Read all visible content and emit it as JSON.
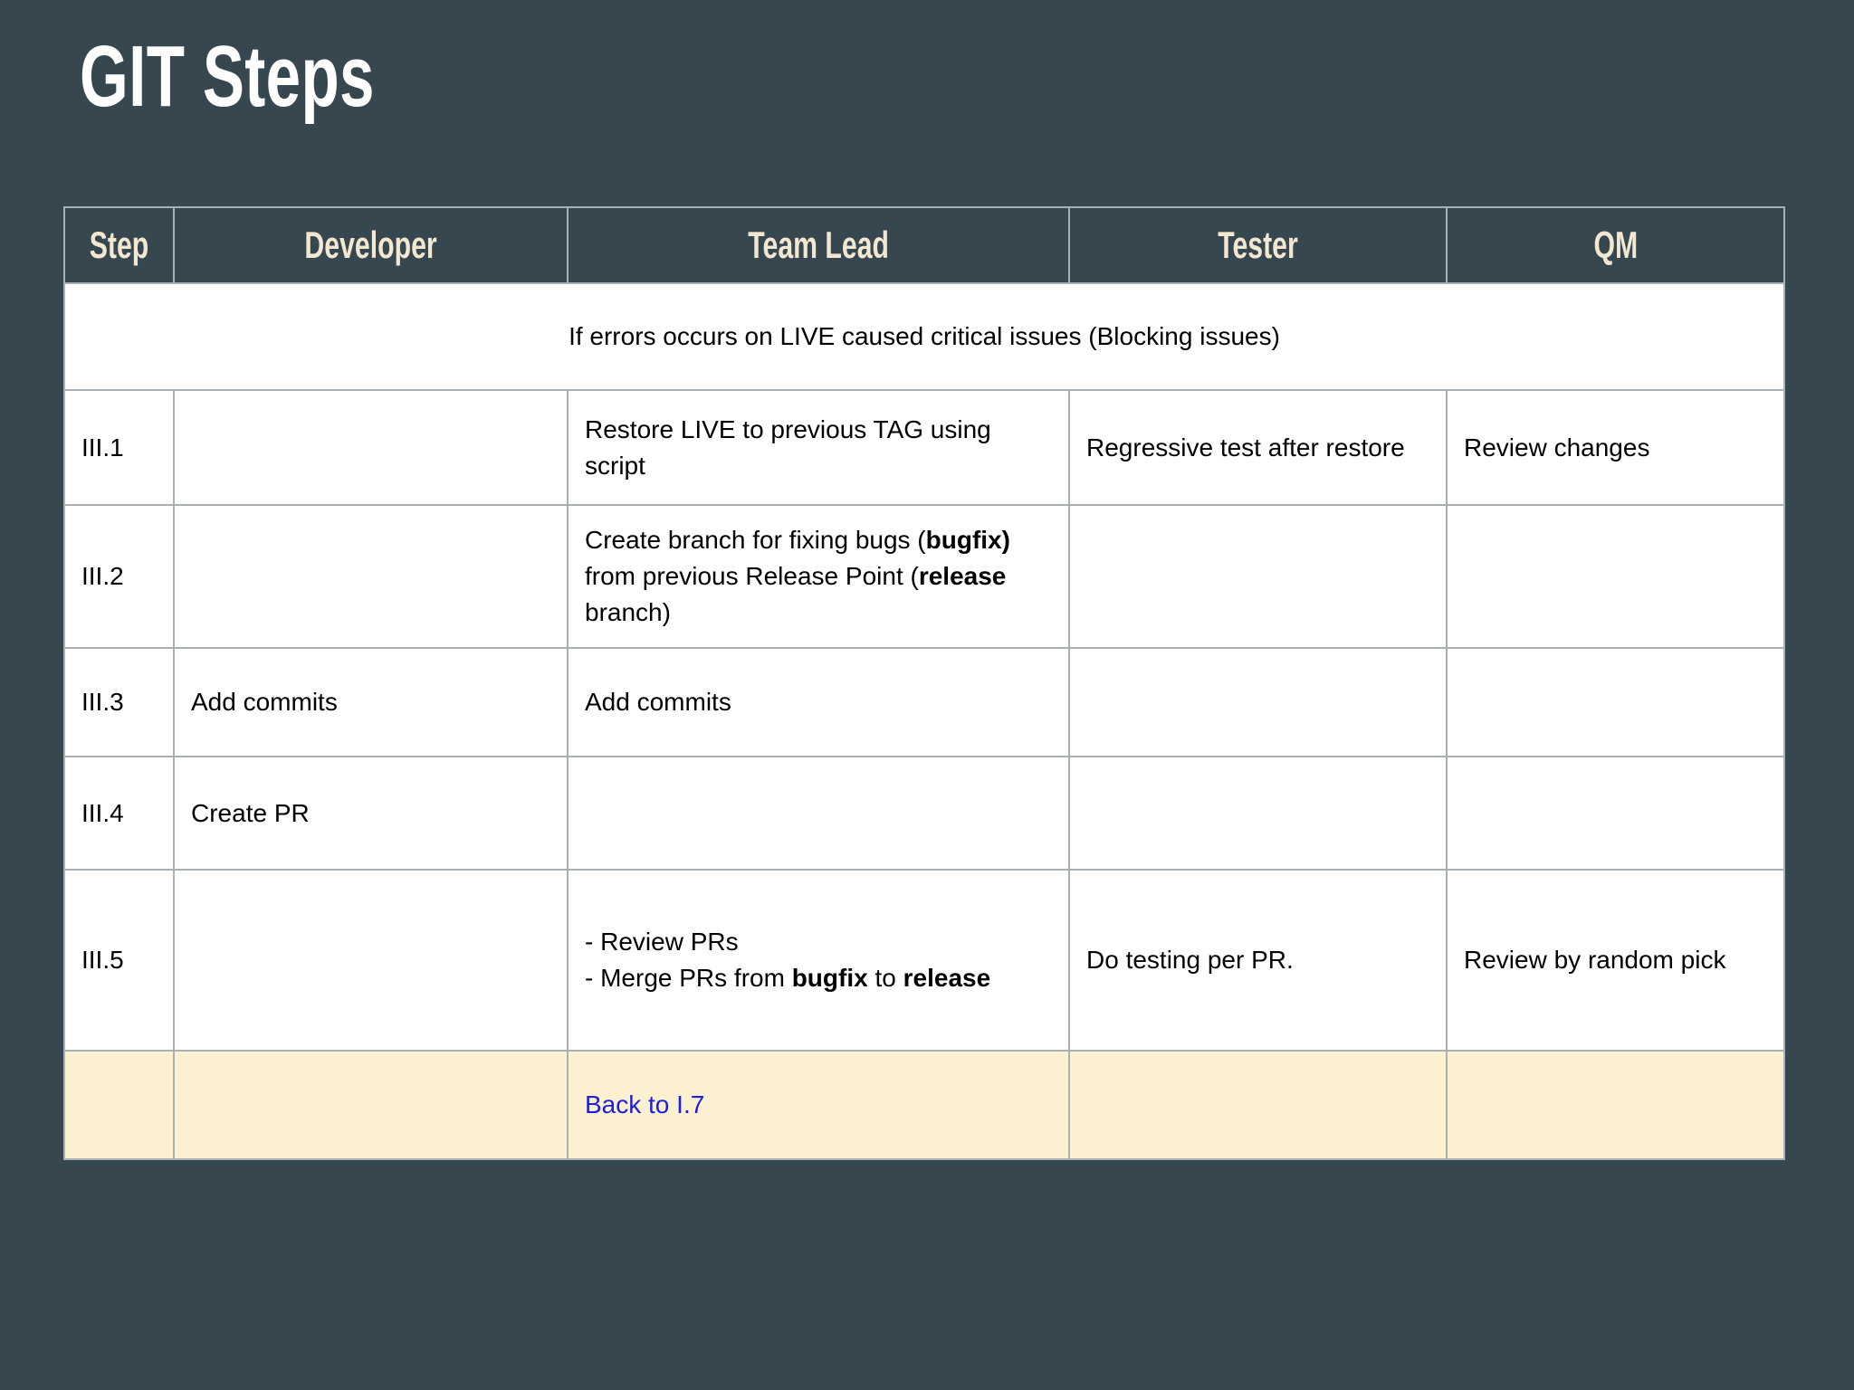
{
  "slide": {
    "title": "GIT Steps"
  },
  "colors": {
    "background": "#37474F",
    "header_text": "#F2E7D1",
    "cell_background": "#FFFFFF",
    "border": "#A9AFB2",
    "banner_red": "#F20000",
    "link_blue": "#1E1EDC",
    "highlight_yellow": "#FBF0CF",
    "title_white": "#FFFFFF"
  },
  "table": {
    "columns": [
      {
        "id": "step",
        "label": "Step"
      },
      {
        "id": "developer",
        "label": "Developer"
      },
      {
        "id": "team-lead",
        "label": "Team Lead"
      },
      {
        "id": "tester",
        "label": "Tester"
      },
      {
        "id": "qm",
        "label": "QM"
      }
    ],
    "banner": {
      "text": "If errors occurs on LIVE caused critical issues (Blocking issues)"
    },
    "rows": [
      {
        "step": "III.1",
        "cells": [
          {
            "segments": []
          },
          {
            "segments": [
              {
                "t": "Restore LIVE to previous TAG using script"
              }
            ]
          },
          {
            "segments": [
              {
                "t": "Regressive test after restore"
              }
            ]
          },
          {
            "segments": [
              {
                "t": "Review changes"
              }
            ]
          }
        ]
      },
      {
        "step": "III.2",
        "cells": [
          {
            "segments": []
          },
          {
            "segments": [
              {
                "t": "Create branch for fixing bugs ("
              },
              {
                "t": "bugfix)",
                "b": true
              },
              {
                "t": " from previous Release Point ("
              },
              {
                "t": "release",
                "b": true
              },
              {
                "t": " branch)"
              }
            ]
          },
          {
            "segments": []
          },
          {
            "segments": []
          }
        ]
      },
      {
        "step": "III.3",
        "cells": [
          {
            "segments": [
              {
                "t": "Add commits"
              }
            ]
          },
          {
            "segments": [
              {
                "t": "Add commits"
              }
            ]
          },
          {
            "segments": []
          },
          {
            "segments": []
          }
        ]
      },
      {
        "step": "III.4",
        "cells": [
          {
            "segments": [
              {
                "t": "Create PR"
              }
            ]
          },
          {
            "segments": []
          },
          {
            "segments": []
          },
          {
            "segments": []
          }
        ]
      },
      {
        "step": "III.5",
        "cells": [
          {
            "segments": []
          },
          {
            "valign": "top",
            "segments": [
              {
                "t": "- Review PRs\n- Merge PRs from "
              },
              {
                "t": "bugfix",
                "b": true
              },
              {
                "t": " to "
              },
              {
                "t": "release",
                "b": true
              }
            ]
          },
          {
            "segments": [
              {
                "t": "Do testing per PR."
              }
            ]
          },
          {
            "segments": [
              {
                "t": "Review by random pick"
              }
            ]
          }
        ]
      }
    ],
    "footer": {
      "link_label": "Back to I.7"
    }
  }
}
